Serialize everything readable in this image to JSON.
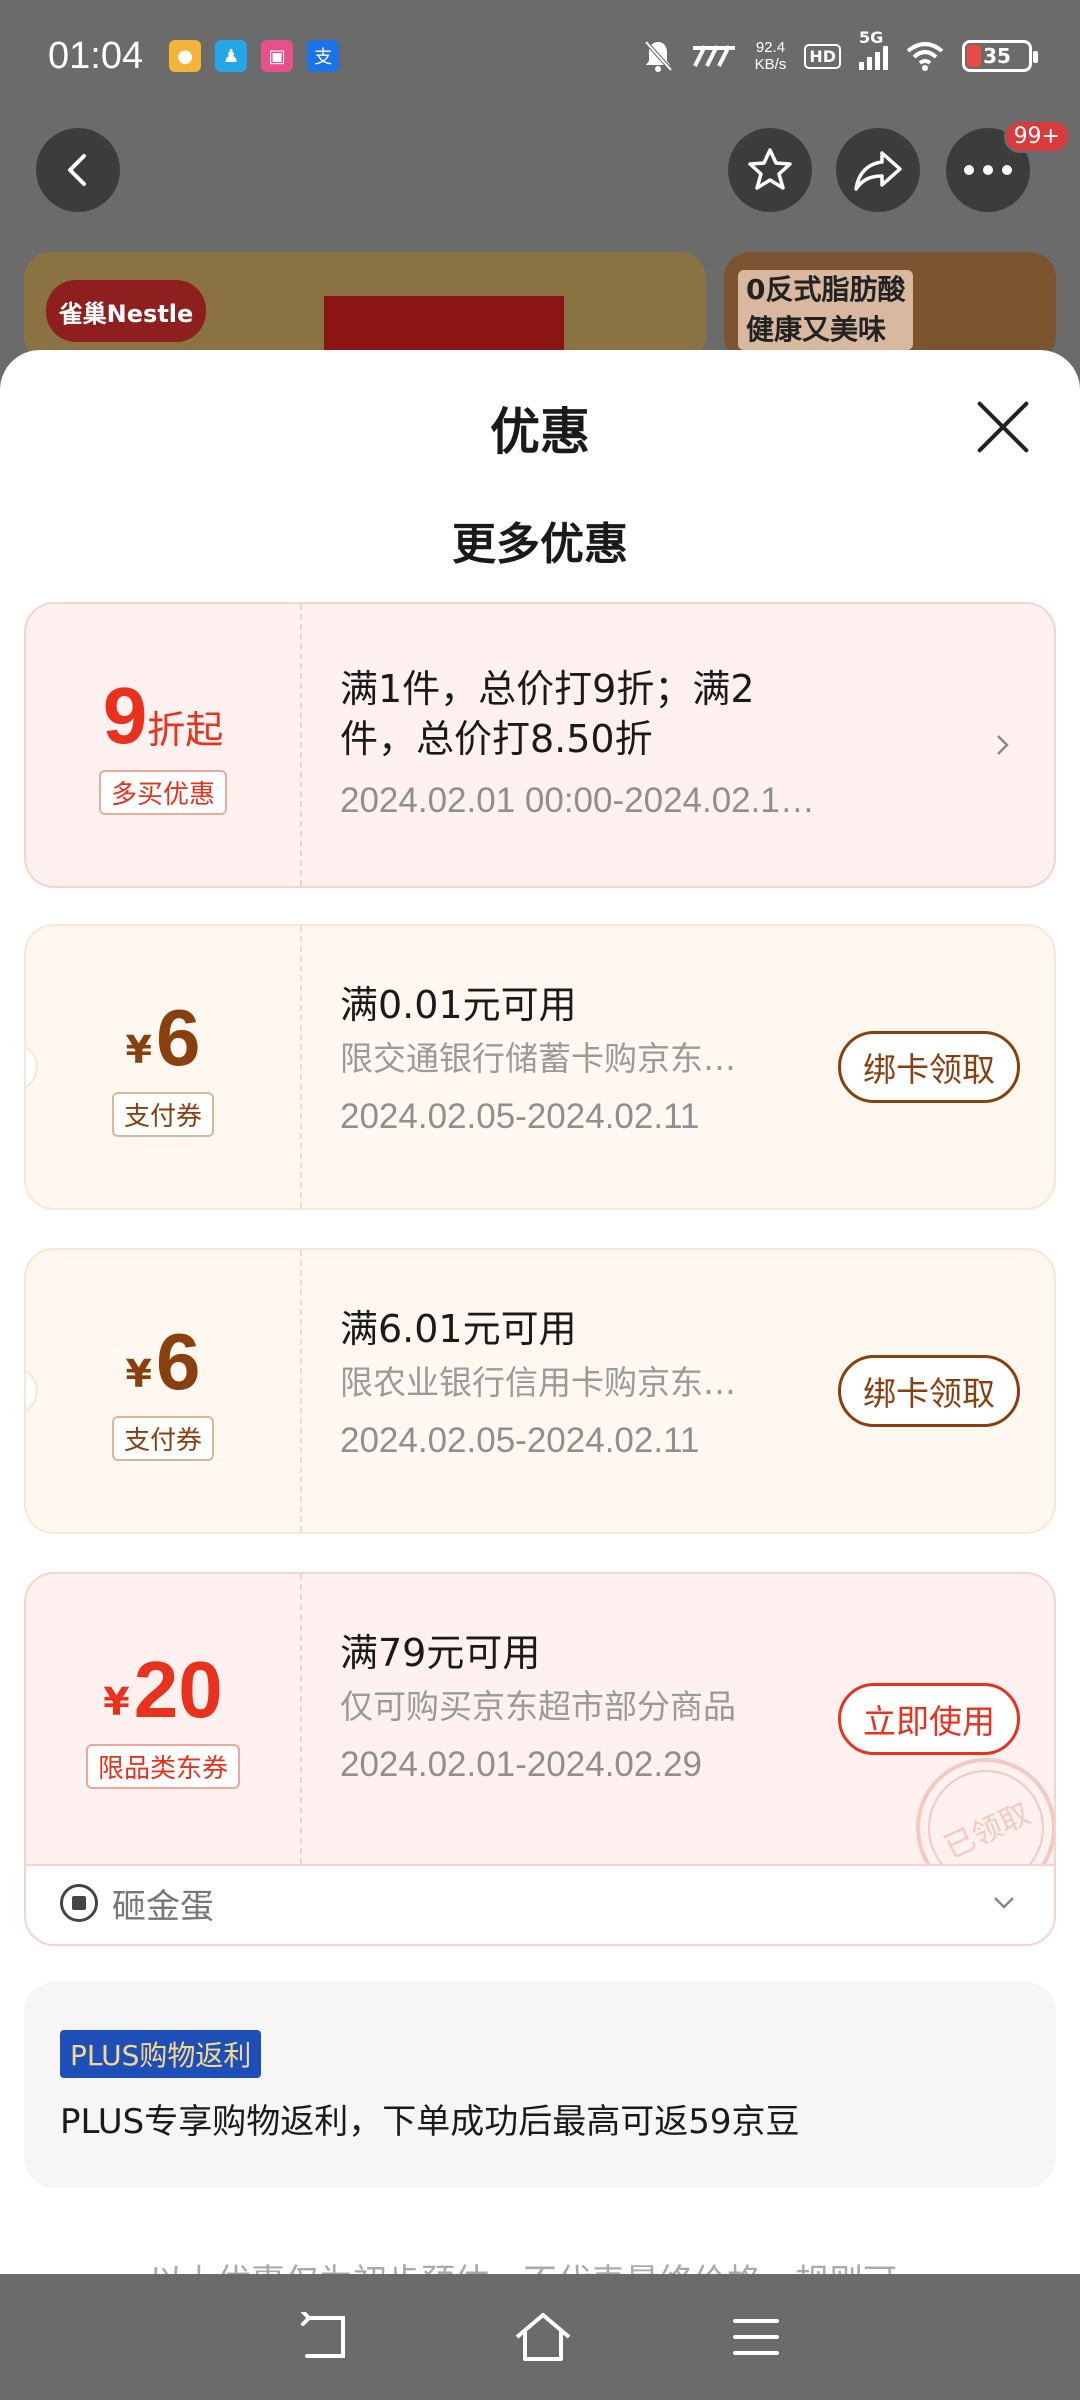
{
  "status": {
    "time": "01:04",
    "speed_value": "92.4",
    "speed_unit": "KB/s",
    "hd": "HD",
    "network": "5G",
    "battery": "35"
  },
  "nav": {
    "more_badge": "99+"
  },
  "banner": {
    "left_logo": "雀巢Nestle",
    "right_line1": "0反式脂肪酸",
    "right_line2": "健康又美味"
  },
  "sheet": {
    "title": "优惠",
    "section_title": "更多优惠"
  },
  "offers": [
    {
      "amount": "9",
      "suffix": "折起",
      "tag": "多买优惠",
      "title_line1": "满1件，总价打9折；满2",
      "title_line2": "件，总价打8.50折",
      "date": "2024.02.01 00:00-2024.02.1…"
    },
    {
      "currency": "¥",
      "amount": "6",
      "tag": "支付券",
      "title": "满0.01元可用",
      "desc": "限交通银行储蓄卡购京东…",
      "date": "2024.02.05-2024.02.11",
      "button": "绑卡领取"
    },
    {
      "currency": "¥",
      "amount": "6",
      "tag": "支付券",
      "title": "满6.01元可用",
      "desc": "限农业银行信用卡购京东…",
      "date": "2024.02.05-2024.02.11",
      "button": "绑卡领取"
    },
    {
      "currency": "¥",
      "amount": "20",
      "tag": "限品类东券",
      "title": "满79元可用",
      "desc": "仅可购买京东超市部分商品",
      "date": "2024.02.01-2024.02.29",
      "button": "立即使用",
      "stamp": "已领取"
    }
  ],
  "egg": {
    "label": "砸金蛋"
  },
  "plus": {
    "badge": "PLUS购物返利",
    "text": "PLUS专享购物返利，下单成功后最高可返59京豆"
  },
  "footer_note": "以上优惠仅为初步预估，不代表最终价格，规则可…",
  "icons": {
    "back": "back-arrow-icon",
    "favorite": "star-icon",
    "share": "share-icon",
    "more": "more-dots-icon",
    "close": "close-icon"
  }
}
